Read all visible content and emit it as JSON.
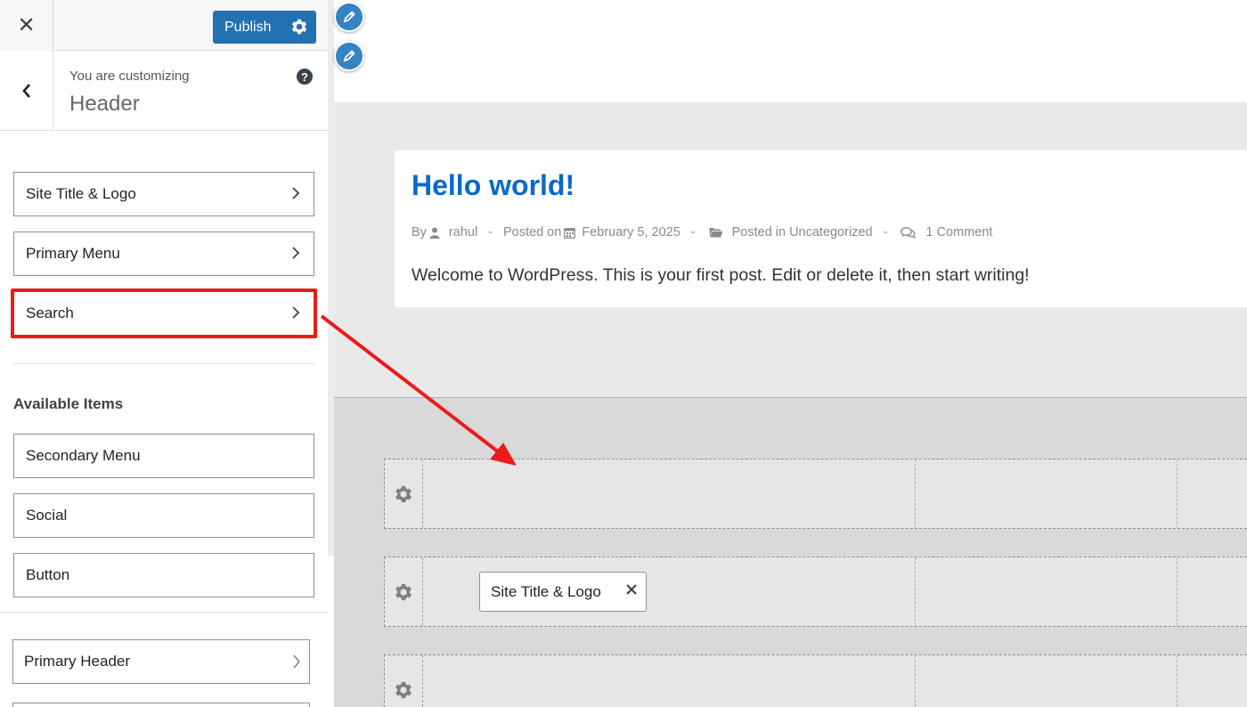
{
  "topbar": {
    "close_label": "✕",
    "publish_label": "Publish"
  },
  "crumb": {
    "subtitle": "You are customizing",
    "title": "Header",
    "help_label": "?"
  },
  "active_items": [
    {
      "label": "Site Title & Logo"
    },
    {
      "label": "Primary Menu"
    },
    {
      "label": "Search"
    }
  ],
  "available": {
    "heading": "Available Items",
    "items": [
      {
        "label": "Secondary Menu"
      },
      {
        "label": "Social"
      },
      {
        "label": "Button"
      }
    ]
  },
  "sections": [
    {
      "label": "Primary Header"
    }
  ],
  "post": {
    "title": "Hello world!",
    "meta": {
      "by": "By",
      "author": "rahul",
      "posted_on": "Posted on",
      "date": "February 5, 2025",
      "posted_in": "Posted in",
      "category": "Uncategorized",
      "comments": "1 Comment",
      "separator": "-"
    },
    "excerpt": "Welcome to WordPress. This is your first post. Edit or delete it, then start writing!"
  },
  "builder": {
    "chip_label": "Site Title & Logo"
  },
  "colors": {
    "accent": "#2271b1",
    "annotation": "#ea1b1b",
    "link": "#0a6ac8"
  },
  "icons": [
    "close-icon",
    "gear-icon",
    "back-chevron-icon",
    "help-icon",
    "chevron-right-icon",
    "pencil-icon",
    "user-icon",
    "calendar-icon",
    "folder-icon",
    "comment-icon",
    "remove-icon",
    "red-arrow"
  ]
}
